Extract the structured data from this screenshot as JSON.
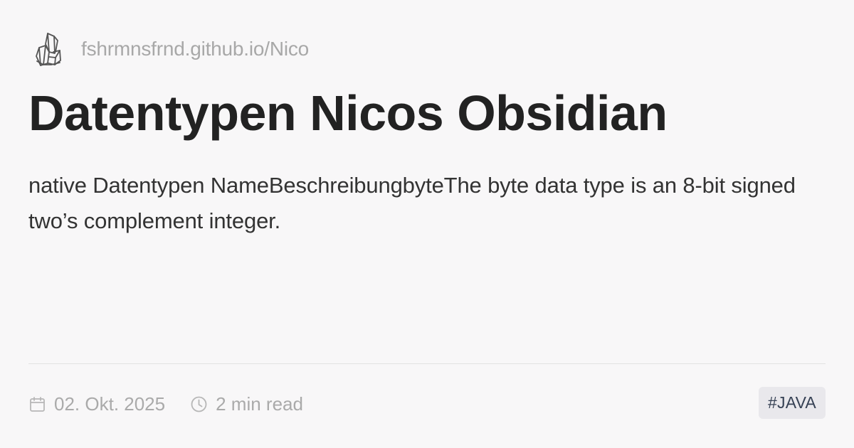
{
  "site": {
    "logo_icon": "crystal-logo-icon",
    "url": "fshrmnsfrnd.github.io/Nico"
  },
  "article": {
    "title": "Datentypen Nicos Obsidian",
    "description": "native Datentypen NameBeschreibungbyteThe byte data type is an 8-bit signed two’s complement integer."
  },
  "meta": {
    "date_icon": "calendar-icon",
    "date": "02. Okt. 2025",
    "read_time_icon": "clock-icon",
    "read_time": "2 min read"
  },
  "tags": [
    {
      "label": "#JAVA"
    }
  ],
  "colors": {
    "background": "#f8f7f8",
    "title": "#222222",
    "muted": "#aaaaaa",
    "tag_background": "#e9e8ec",
    "tag_text": "#364154"
  }
}
